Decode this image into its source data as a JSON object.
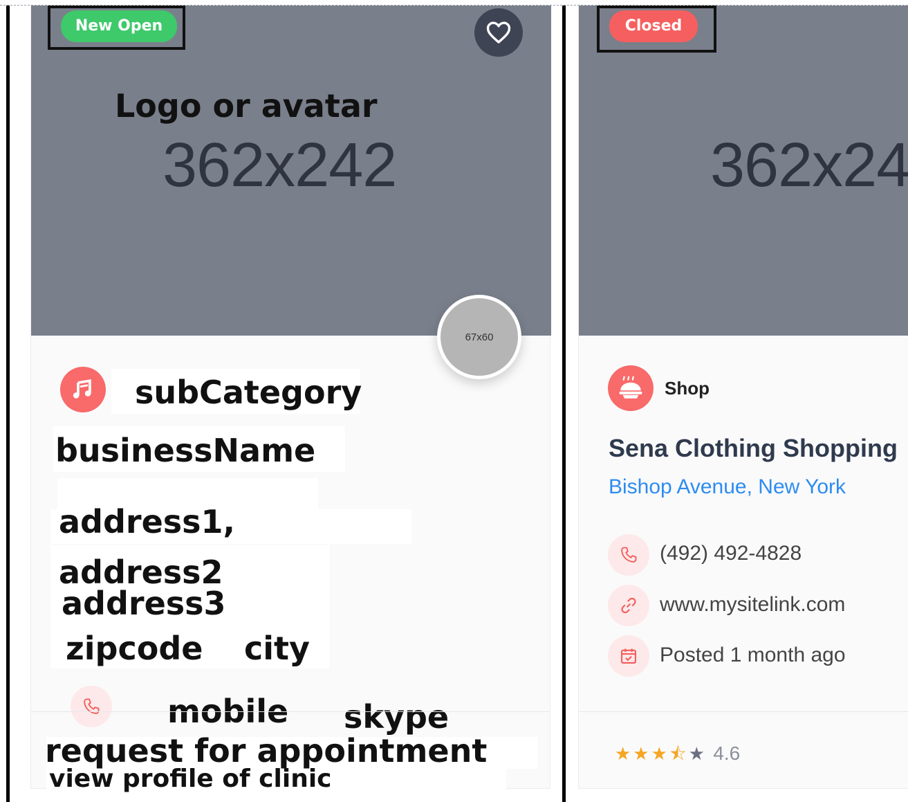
{
  "card1": {
    "badge": "New Open",
    "badge_color": "#3ec96b",
    "image_label": "Logo or avatar",
    "image_size": "362x242",
    "avatar_size": "67x60",
    "sub_category": "subCategory",
    "business_name": "businessName",
    "address1": "address1,",
    "address2": "address2",
    "address3": "address3",
    "zipcode": "zipcode",
    "city": "city",
    "mobile": "mobile",
    "skype": "skype",
    "appointment": "request for appointment",
    "view_profile": "view profile of clinic"
  },
  "card2": {
    "badge": "Closed",
    "badge_color": "#f55f5f",
    "image_size": "362x24",
    "category": "Shop",
    "business_name": "Sena Clothing Shopping",
    "address": "Bishop Avenue, New York",
    "phone": "(492) 492-4828",
    "website": "www.mysitelink.com",
    "posted": "Posted 1 month ago",
    "stars": "★★★",
    "half_star": "⯪",
    "empty_star": "★",
    "rating": "4.6"
  },
  "colors": {
    "accent": "#f96a6a",
    "link": "#2d8cf0",
    "image_bg": "#7a7f8c",
    "star": "#f5a623"
  }
}
